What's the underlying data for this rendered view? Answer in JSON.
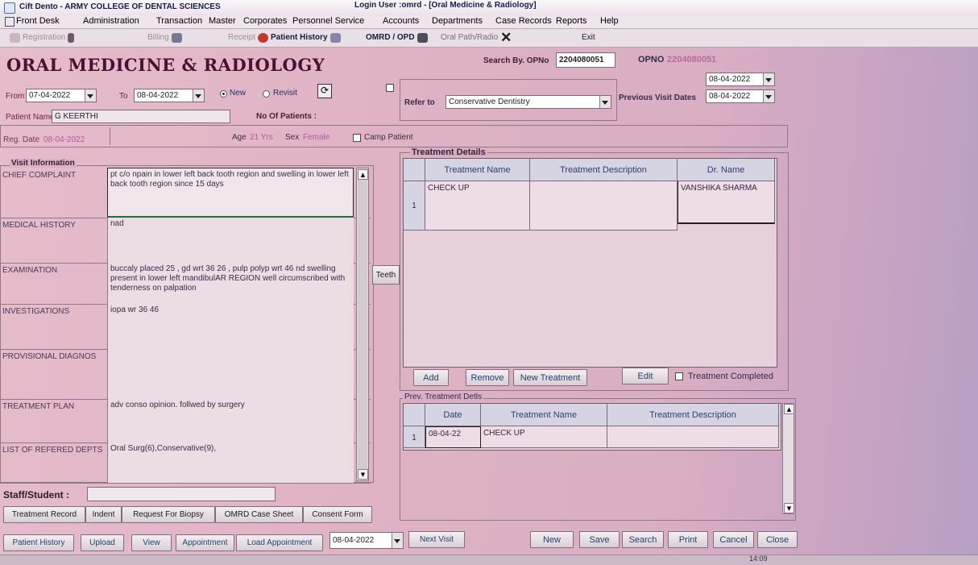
{
  "window": {
    "title": "Cift Dento - ARMY COLLEGE OF DENTAL SCIENCES",
    "login": "Login User :omrd - [Oral Medicine & Radiology]"
  },
  "menu": [
    "Front Desk",
    "Administration",
    "Transaction",
    "Master",
    "Corporates",
    "Personnel Service",
    "Accounts",
    "Departments",
    "Case Records",
    "Reports",
    "Help"
  ],
  "toolbar": {
    "registration": "Registration",
    "billing": "Billing",
    "receipt": "Receipt",
    "patient_history": "Patient History",
    "omrd_opd": "OMRD / OPD",
    "oral_path": "Oral Path/Radio",
    "exit": "Exit"
  },
  "heading": "ORAL MEDICINE & RADIOLOGY",
  "search": {
    "label": "Search By. OPNo",
    "value": "2204080051",
    "opno_label": "OPNO",
    "opno_value": "2204080051"
  },
  "filters": {
    "from_label": "From",
    "from": "07-04-2022",
    "to_label": "To",
    "to": "08-04-2022",
    "new_label": "New",
    "revisit_label": "Revisit",
    "patient_name_label": "Patient Name",
    "patient_name": "G KEERTHI",
    "no_of_patients_label": "No Of Patients :",
    "refer_label": "Refer to",
    "refer_value": "Conservative Dentistry",
    "visit_date_top": "08-04-2022",
    "prev_visit_label": "Previous Visit Dates",
    "prev_visit": "08-04-2022"
  },
  "patient": {
    "reg_date_label": "Reg. Date",
    "reg_date": "08-04-2022",
    "age_label": "Age",
    "age": "21 Yrs",
    "sex_label": "Sex",
    "sex": "Female",
    "camp_label": "Camp Patient"
  },
  "visit": {
    "title": "Visit Information",
    "rows": [
      {
        "label": "CHIEF COMPLAINT",
        "text": "pt c/o npain in lower left back tooth region and swelling in lower left back tooth region since 15 days"
      },
      {
        "label": "MEDICAL HISTORY",
        "text": "nad"
      },
      {
        "label": "EXAMINATION",
        "text": "buccaly placed 25 , gd wrt 36 26 , pulp polyp wrt 46 nd swelling present in lower left mandibulAR REGION well circumscribed with tenderness on palpation"
      },
      {
        "label": "INVESTIGATIONS",
        "text": "iopa wr 36 46"
      },
      {
        "label": "PROVISIONAL DIAGNOS",
        "text": ""
      },
      {
        "label": "TREATMENT PLAN",
        "text": "adv conso opinion. follwed by surgery"
      },
      {
        "label": "LIST OF REFERED DEPTS",
        "text": "Oral Surg(6),Conservative(9),"
      }
    ],
    "teeth_button": "Teeth"
  },
  "treatment": {
    "title": "Treatment Details",
    "columns": [
      "Treatment Name",
      "Treatment Description",
      "Dr. Name"
    ],
    "rows": [
      {
        "num": "1",
        "name": "CHECK UP",
        "desc": "",
        "doctor": "VANSHIKA SHARMA"
      }
    ],
    "add": "Add",
    "remove": "Remove",
    "new_treatment": "New Treatment",
    "edit": "Edit",
    "completed": "Treatment Completed"
  },
  "prev": {
    "title": "Prev. Treatment Detls",
    "columns": [
      "Date",
      "Treatment Name",
      "Treatment Description"
    ],
    "rows": [
      {
        "num": "1",
        "date": "08-04-22",
        "name": "CHECK UP",
        "desc": ""
      }
    ]
  },
  "staff": {
    "label": "Staff/Student :"
  },
  "record_buttons": [
    "Treatment Record",
    "Indent",
    "Request For Biopsy",
    "OMRD Case Sheet",
    "Consent Form"
  ],
  "bottom": {
    "patient_history": "Patient History",
    "upload": "Upload",
    "view": "View",
    "appointment": "Appointment",
    "load_appointment": "Load Appointment",
    "date": "08-04-2022",
    "next_visit": "Next Visit",
    "new": "New",
    "save": "Save",
    "search": "Search",
    "print": "Print",
    "cancel": "Cancel",
    "close": "Close"
  },
  "clock": "14:09"
}
